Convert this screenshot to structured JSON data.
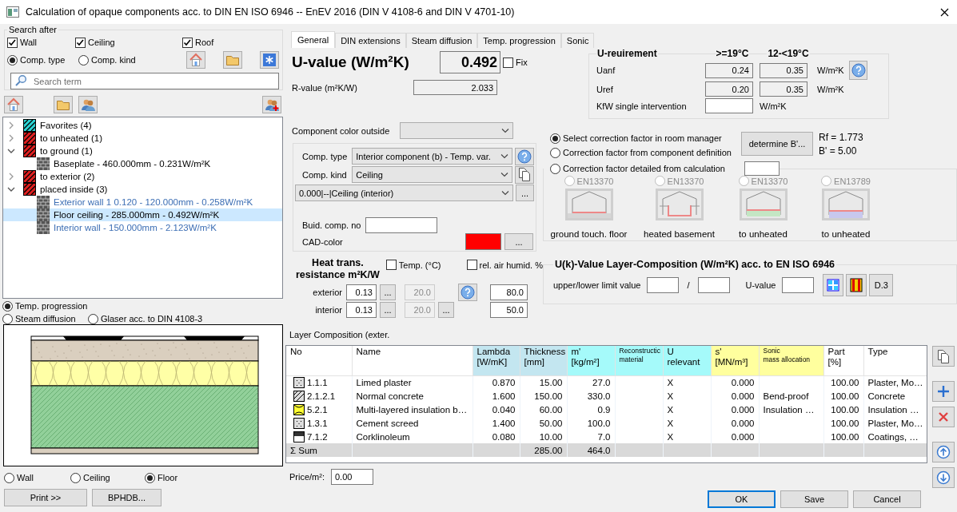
{
  "window": {
    "title": "Calculation of opaque components acc. to DIN EN ISO 6946 -- EnEV 2016 (DIN V 4108-6 and DIN V 4701-10)"
  },
  "search": {
    "legend": "Search after",
    "filters": [
      {
        "label": "Wall",
        "checked": true
      },
      {
        "label": "Ceiling",
        "checked": true
      },
      {
        "label": "Roof",
        "checked": true
      }
    ],
    "modes": [
      {
        "label": "Comp. type",
        "selected": true
      },
      {
        "label": "Comp. kind",
        "selected": false
      }
    ],
    "placeholder": "Search term"
  },
  "tree": [
    {
      "label": "Favorites (4)",
      "color": "#2ad4d4",
      "expanded": false,
      "selected": false
    },
    {
      "label": "to unheated (1)",
      "color": "#e02020",
      "expanded": false,
      "selected": false
    },
    {
      "label": "to ground (1)",
      "color": "#e02020",
      "expanded": true,
      "selected": false,
      "children": [
        {
          "label": "Baseplate - 460.000mm - 0.231W/m²K",
          "color": "#000000",
          "selected": false
        }
      ]
    },
    {
      "label": "to exterior (2)",
      "color": "#e02020",
      "expanded": false,
      "selected": false
    },
    {
      "label": "placed inside (3)",
      "color": "#e02020",
      "expanded": true,
      "selected": false,
      "children": [
        {
          "label": "Exterior wall 1 0.120 - 120.000mm - 0.258W/m²K",
          "color": "#3c6eb4",
          "selected": false
        },
        {
          "label": "Floor ceiling - 285.000mm - 0.492W/m²K",
          "color": "#000000",
          "selected": true
        },
        {
          "label": "Interior wall - 150.000mm - 2.123W/m²K",
          "color": "#3c6eb4",
          "selected": false
        }
      ]
    }
  ],
  "view_modes": [
    {
      "label": "Temp. progression",
      "selected": true
    },
    {
      "label": "Steam diffusion",
      "selected": false
    },
    {
      "label": "Glaser acc. to  DIN 4108-3",
      "selected": false
    }
  ],
  "orientation": [
    {
      "label": "Wall",
      "selected": false
    },
    {
      "label": "Ceiling",
      "selected": false
    },
    {
      "label": "Floor",
      "selected": true
    }
  ],
  "left_buttons": [
    "Print >>",
    "BPHDB..."
  ],
  "tabs": [
    {
      "label": "General",
      "selected": true
    },
    {
      "label": "DIN extensions",
      "selected": false
    },
    {
      "label": "Steam diffusion",
      "selected": false
    },
    {
      "label": "Temp. progression",
      "selected": false
    },
    {
      "label": "Sonic",
      "selected": false
    }
  ],
  "u_value": {
    "label": "U-value  (W/m²K)",
    "value": "0.492",
    "fix_label": "Fix",
    "fix": false
  },
  "r_value": {
    "label": "R-value (m²K/W)",
    "value": "2.033"
  },
  "component_color": {
    "label": "Component color outside"
  },
  "component": {
    "type_label": "Comp. type",
    "type": "Interior component (b) - Temp. var.",
    "kind_label": "Comp. kind",
    "kind": "Ceiling",
    "reference": "0.000|--|Ceiling (interior)",
    "reference_button": "...",
    "number_label": "Buid. comp. no",
    "cad_label": "CAD-color",
    "cad_button": "..."
  },
  "heat_transfer": {
    "title": "Heat trans. resistance m²K/W",
    "temp_label": "Temp. (°C)",
    "temp": false,
    "humid_label": "rel. air humid. %",
    "humid": false,
    "rows": [
      {
        "label": "exterior",
        "resistance": "0.13",
        "resistance_button": "...",
        "temperature": "20.0",
        "humidity": "80.0"
      },
      {
        "label": "interior",
        "resistance": "0.13",
        "resistance_button": "...",
        "temperature": "20.0",
        "temperature_button": "...",
        "humidity": "50.0"
      }
    ]
  },
  "u_requirement": {
    "title": "U-reuirement",
    "columns": [
      ">=19°C",
      "12-<19°C"
    ],
    "rows": [
      {
        "label": "Uanf",
        "values": [
          "0.24",
          "0.35"
        ],
        "unit": "W/m²K"
      },
      {
        "label": "Uref",
        "values": [
          "0.20",
          "0.35"
        ],
        "unit": "W/m²K"
      }
    ],
    "kfw": {
      "label": "KfW single intervention",
      "unit": "W/m²K"
    }
  },
  "correction": {
    "options": [
      {
        "label": "Select correction factor in room manager",
        "selected": true
      },
      {
        "label": "Correction factor from component definition",
        "selected": false
      },
      {
        "label": "Correction factor detailed from calculation",
        "selected": false
      }
    ],
    "button": "determine B'...",
    "rf": "Rf = 1.773",
    "b": "B' = 5.00",
    "cases": [
      {
        "norm": "EN13370",
        "label": "ground touch. floor",
        "kind": "ground",
        "selected": false,
        "disabled": true
      },
      {
        "norm": "EN13370",
        "label": "heated basement",
        "kind": "basement",
        "selected": false,
        "disabled": true
      },
      {
        "norm": "EN13370",
        "label": "to unheated",
        "kind": "unheated-floor",
        "selected": false,
        "disabled": true
      },
      {
        "norm": "EN13789",
        "label": "to unheated",
        "kind": "unheated-space",
        "selected": false,
        "disabled": true
      }
    ]
  },
  "uk_value": {
    "title": "U(k)-Value Layer-Composition (W/m²K) acc. to EN ISO 6946",
    "limit_label": "upper/lower limit value",
    "separator": "/",
    "u_label": "U-value",
    "button": "D.3"
  },
  "layers": {
    "title": "Layer Composition (exter.",
    "columns": [
      {
        "label": [
          "No"
        ]
      },
      {
        "label": [
          "Name"
        ]
      },
      {
        "label": [
          "Lambda",
          "[W/mK]"
        ],
        "color": "#c3e6f0"
      },
      {
        "label": [
          "Thickness",
          "[mm]"
        ],
        "color": "#c3e6f0"
      },
      {
        "label": [
          "m'",
          "[kg/m²]"
        ],
        "color": "#a5fafa"
      },
      {
        "label": [
          "Reconstructic",
          "material"
        ],
        "color": "#a5fafa"
      },
      {
        "label": [
          "U",
          "relevant"
        ],
        "color": "#a5fafa"
      },
      {
        "label": [
          "s'",
          "[MN/m³]"
        ],
        "color": "#ffff9e"
      },
      {
        "label": [
          "Sonic",
          "mass allocation"
        ],
        "color": "#ffff9e"
      },
      {
        "label": [
          "Part",
          "[%]"
        ]
      },
      {
        "label": [
          "Type"
        ]
      }
    ],
    "rows": [
      {
        "kind": "dots",
        "cells": [
          "1.1.1",
          "Limed plaster",
          "0.870",
          "15.00",
          "27.0",
          null,
          "X",
          "0.000",
          null,
          "100.00",
          "Plaster, Mo…"
        ]
      },
      {
        "kind": "hatch",
        "cells": [
          "2.1.2.1",
          "Normal concrete",
          "1.600",
          "150.00",
          "330.0",
          null,
          "X",
          "0.000",
          "Bend-proof",
          "100.00",
          "Concrete"
        ]
      },
      {
        "kind": "insulation",
        "cells": [
          "5.2.1",
          "Multi-layered insulation b…",
          "0.040",
          "60.00",
          "0.9",
          null,
          "X",
          "0.000",
          "Insulation …",
          "100.00",
          "Insulation …"
        ]
      },
      {
        "kind": "dots",
        "cells": [
          "1.3.1",
          "Cement screed",
          "1.400",
          "50.00",
          "100.0",
          null,
          "X",
          "0.000",
          null,
          "100.00",
          "Plaster, Mo…"
        ]
      },
      {
        "kind": "layer",
        "cells": [
          "7.1.2",
          "Corklinoleum",
          "0.080",
          "10.00",
          "7.0",
          null,
          "X",
          "0.000",
          null,
          "100.00",
          "Coatings, …"
        ]
      }
    ],
    "sum": {
      "cells": [
        "Σ Sum",
        null,
        null,
        "285.00",
        "464.0",
        null,
        null,
        null,
        null,
        null,
        null
      ]
    }
  },
  "price": {
    "label": "Price/m²:",
    "value": "0.00"
  },
  "buttons": [
    {
      "label": "OK",
      "default": true
    },
    {
      "label": "Save",
      "default": false
    },
    {
      "label": "Cancel",
      "default": false
    }
  ]
}
